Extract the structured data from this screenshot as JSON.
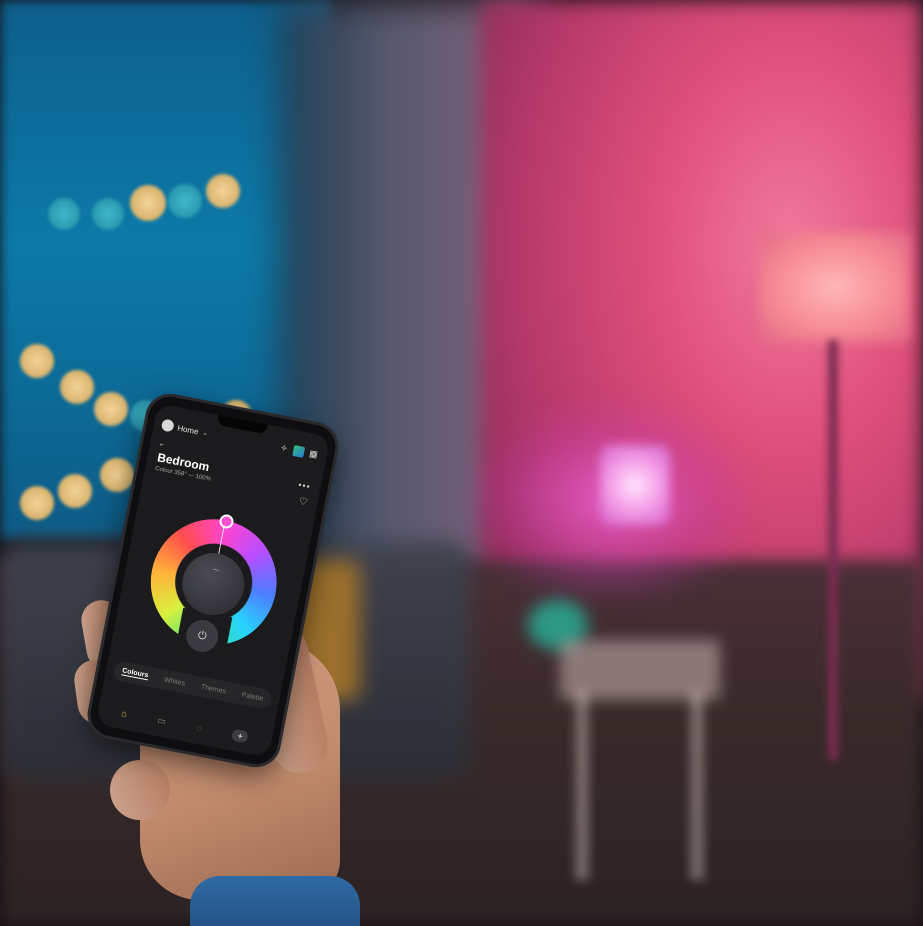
{
  "app": {
    "home_label": "Home",
    "room_title": "Bedroom",
    "room_subtitle": "Colour 358° — 100%",
    "mode_tabs": [
      "Colours",
      "Whites",
      "Themes",
      "Palette"
    ],
    "active_tab": "Colours",
    "icons": {
      "home_chevron": "chevron-down-icon",
      "topbar": [
        "add-device-icon",
        "scene-thumbnail-icon",
        "grid-icon"
      ],
      "back": "chevron-down-icon",
      "more": "more-icon",
      "favorite": "heart-icon",
      "power": "power-icon",
      "nav": [
        "home-icon",
        "rooms-icon",
        "scenes-icon",
        "add-icon"
      ]
    },
    "colors": {
      "selected_hue": "#ff52d3",
      "nav_active": "#f5c84a"
    }
  }
}
